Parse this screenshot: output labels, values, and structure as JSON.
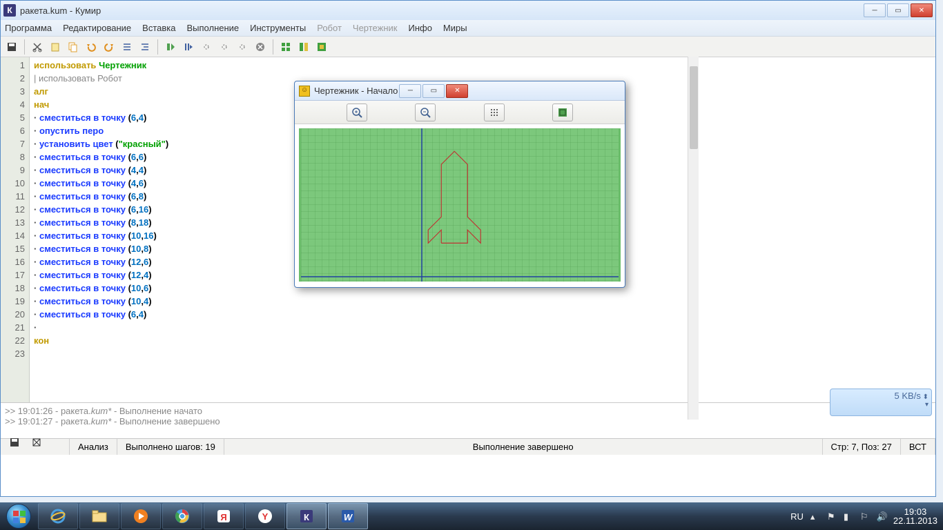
{
  "title": "ракета.kum - Кумир",
  "menu": [
    "Программа",
    "Редактирование",
    "Вставка",
    "Выполнение",
    "Инструменты",
    "Робот",
    "Чертежник",
    "Инфо",
    "Миры"
  ],
  "menu_disabled": [
    5,
    6
  ],
  "code_lines": [
    {
      "n": 1,
      "html": "<span class='kw'>использовать</span> <span class='str'>Чертежник</span>"
    },
    {
      "n": 2,
      "html": "<span class='gray'>| использовать Робот</span>"
    },
    {
      "n": 3,
      "html": "<span class='kw'>алг</span>"
    },
    {
      "n": 4,
      "html": "<span class='kw'>нач</span>"
    },
    {
      "n": 5,
      "html": "<span class='dot'>·</span> <span class='cmd'>сместиться в точку</span> (<span class='num'>6</span>,<span class='num'>4</span>)"
    },
    {
      "n": 6,
      "html": "<span class='dot'>·</span> <span class='cmd'>опустить перо</span>"
    },
    {
      "n": 7,
      "html": "<span class='dot'>·</span> <span class='cmd'>установить цвет</span> (<span class='str'>\"красный\"</span>)"
    },
    {
      "n": 8,
      "html": "<span class='dot'>·</span> <span class='cmd'>сместиться в точку</span> (<span class='num'>6</span>,<span class='num'>6</span>)"
    },
    {
      "n": 9,
      "html": "<span class='dot'>·</span> <span class='cmd'>сместиться в точку</span> (<span class='num'>4</span>,<span class='num'>4</span>)"
    },
    {
      "n": 10,
      "html": "<span class='dot'>·</span> <span class='cmd'>сместиться в точку</span> (<span class='num'>4</span>,<span class='num'>6</span>)"
    },
    {
      "n": 11,
      "html": "<span class='dot'>·</span> <span class='cmd'>сместиться в точку</span> (<span class='num'>6</span>,<span class='num'>8</span>)"
    },
    {
      "n": 12,
      "html": "<span class='dot'>·</span> <span class='cmd'>сместиться в точку</span> (<span class='num'>6</span>,<span class='num'>16</span>)"
    },
    {
      "n": 13,
      "html": "<span class='dot'>·</span> <span class='cmd'>сместиться в точку</span> (<span class='num'>8</span>,<span class='num'>18</span>)"
    },
    {
      "n": 14,
      "html": "<span class='dot'>·</span> <span class='cmd'>сместиться в точку</span> (<span class='num'>10</span>,<span class='num'>16</span>)"
    },
    {
      "n": 15,
      "html": "<span class='dot'>·</span> <span class='cmd'>сместиться в точку</span> (<span class='num'>10</span>,<span class='num'>8</span>)"
    },
    {
      "n": 16,
      "html": "<span class='dot'>·</span> <span class='cmd'>сместиться в точку</span> (<span class='num'>12</span>,<span class='num'>6</span>)"
    },
    {
      "n": 17,
      "html": "<span class='dot'>·</span> <span class='cmd'>сместиться в точку</span> (<span class='num'>12</span>,<span class='num'>4</span>)"
    },
    {
      "n": 18,
      "html": "<span class='dot'>·</span> <span class='cmd'>сместиться в точку</span> (<span class='num'>10</span>,<span class='num'>6</span>)"
    },
    {
      "n": 19,
      "html": "<span class='dot'>·</span> <span class='cmd'>сместиться в точку</span> (<span class='num'>10</span>,<span class='num'>4</span>)"
    },
    {
      "n": 20,
      "html": "<span class='dot'>·</span> <span class='cmd'>сместиться в точку</span> (<span class='num'>6</span>,<span class='num'>4</span>)"
    },
    {
      "n": 21,
      "html": "<span class='dot'>·</span>"
    },
    {
      "n": 22,
      "html": "<span class='kw'>кон</span>"
    },
    {
      "n": 23,
      "html": ""
    }
  ],
  "console": [
    ">> 19:01:26 - ракета.kum*  - Выполнение начато",
    ">> 19:01:27 - ракета.kum*  - Выполнение завершено"
  ],
  "status": {
    "analyze": "Анализ",
    "steps": "Выполнено шагов: 19",
    "state": "Выполнение завершено",
    "pos": "Стр: 7, Поз: 27",
    "mode": "ВСТ"
  },
  "draft": {
    "title": "Чертежник - Начало"
  },
  "notif": "5 KB/s",
  "tray": {
    "lang": "RU",
    "time": "19:03",
    "date": "22.11.2013"
  }
}
